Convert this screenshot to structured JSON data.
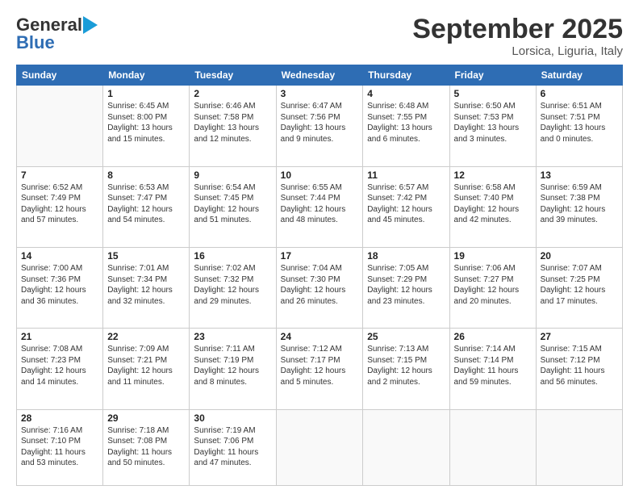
{
  "header": {
    "logo_general": "General",
    "logo_blue": "Blue",
    "title": "September 2025",
    "location": "Lorsica, Liguria, Italy"
  },
  "calendar": {
    "days_of_week": [
      "Sunday",
      "Monday",
      "Tuesday",
      "Wednesday",
      "Thursday",
      "Friday",
      "Saturday"
    ],
    "weeks": [
      [
        {
          "day": "",
          "info": ""
        },
        {
          "day": "1",
          "info": "Sunrise: 6:45 AM\nSunset: 8:00 PM\nDaylight: 13 hours\nand 15 minutes."
        },
        {
          "day": "2",
          "info": "Sunrise: 6:46 AM\nSunset: 7:58 PM\nDaylight: 13 hours\nand 12 minutes."
        },
        {
          "day": "3",
          "info": "Sunrise: 6:47 AM\nSunset: 7:56 PM\nDaylight: 13 hours\nand 9 minutes."
        },
        {
          "day": "4",
          "info": "Sunrise: 6:48 AM\nSunset: 7:55 PM\nDaylight: 13 hours\nand 6 minutes."
        },
        {
          "day": "5",
          "info": "Sunrise: 6:50 AM\nSunset: 7:53 PM\nDaylight: 13 hours\nand 3 minutes."
        },
        {
          "day": "6",
          "info": "Sunrise: 6:51 AM\nSunset: 7:51 PM\nDaylight: 13 hours\nand 0 minutes."
        }
      ],
      [
        {
          "day": "7",
          "info": "Sunrise: 6:52 AM\nSunset: 7:49 PM\nDaylight: 12 hours\nand 57 minutes."
        },
        {
          "day": "8",
          "info": "Sunrise: 6:53 AM\nSunset: 7:47 PM\nDaylight: 12 hours\nand 54 minutes."
        },
        {
          "day": "9",
          "info": "Sunrise: 6:54 AM\nSunset: 7:45 PM\nDaylight: 12 hours\nand 51 minutes."
        },
        {
          "day": "10",
          "info": "Sunrise: 6:55 AM\nSunset: 7:44 PM\nDaylight: 12 hours\nand 48 minutes."
        },
        {
          "day": "11",
          "info": "Sunrise: 6:57 AM\nSunset: 7:42 PM\nDaylight: 12 hours\nand 45 minutes."
        },
        {
          "day": "12",
          "info": "Sunrise: 6:58 AM\nSunset: 7:40 PM\nDaylight: 12 hours\nand 42 minutes."
        },
        {
          "day": "13",
          "info": "Sunrise: 6:59 AM\nSunset: 7:38 PM\nDaylight: 12 hours\nand 39 minutes."
        }
      ],
      [
        {
          "day": "14",
          "info": "Sunrise: 7:00 AM\nSunset: 7:36 PM\nDaylight: 12 hours\nand 36 minutes."
        },
        {
          "day": "15",
          "info": "Sunrise: 7:01 AM\nSunset: 7:34 PM\nDaylight: 12 hours\nand 32 minutes."
        },
        {
          "day": "16",
          "info": "Sunrise: 7:02 AM\nSunset: 7:32 PM\nDaylight: 12 hours\nand 29 minutes."
        },
        {
          "day": "17",
          "info": "Sunrise: 7:04 AM\nSunset: 7:30 PM\nDaylight: 12 hours\nand 26 minutes."
        },
        {
          "day": "18",
          "info": "Sunrise: 7:05 AM\nSunset: 7:29 PM\nDaylight: 12 hours\nand 23 minutes."
        },
        {
          "day": "19",
          "info": "Sunrise: 7:06 AM\nSunset: 7:27 PM\nDaylight: 12 hours\nand 20 minutes."
        },
        {
          "day": "20",
          "info": "Sunrise: 7:07 AM\nSunset: 7:25 PM\nDaylight: 12 hours\nand 17 minutes."
        }
      ],
      [
        {
          "day": "21",
          "info": "Sunrise: 7:08 AM\nSunset: 7:23 PM\nDaylight: 12 hours\nand 14 minutes."
        },
        {
          "day": "22",
          "info": "Sunrise: 7:09 AM\nSunset: 7:21 PM\nDaylight: 12 hours\nand 11 minutes."
        },
        {
          "day": "23",
          "info": "Sunrise: 7:11 AM\nSunset: 7:19 PM\nDaylight: 12 hours\nand 8 minutes."
        },
        {
          "day": "24",
          "info": "Sunrise: 7:12 AM\nSunset: 7:17 PM\nDaylight: 12 hours\nand 5 minutes."
        },
        {
          "day": "25",
          "info": "Sunrise: 7:13 AM\nSunset: 7:15 PM\nDaylight: 12 hours\nand 2 minutes."
        },
        {
          "day": "26",
          "info": "Sunrise: 7:14 AM\nSunset: 7:14 PM\nDaylight: 11 hours\nand 59 minutes."
        },
        {
          "day": "27",
          "info": "Sunrise: 7:15 AM\nSunset: 7:12 PM\nDaylight: 11 hours\nand 56 minutes."
        }
      ],
      [
        {
          "day": "28",
          "info": "Sunrise: 7:16 AM\nSunset: 7:10 PM\nDaylight: 11 hours\nand 53 minutes."
        },
        {
          "day": "29",
          "info": "Sunrise: 7:18 AM\nSunset: 7:08 PM\nDaylight: 11 hours\nand 50 minutes."
        },
        {
          "day": "30",
          "info": "Sunrise: 7:19 AM\nSunset: 7:06 PM\nDaylight: 11 hours\nand 47 minutes."
        },
        {
          "day": "",
          "info": ""
        },
        {
          "day": "",
          "info": ""
        },
        {
          "day": "",
          "info": ""
        },
        {
          "day": "",
          "info": ""
        }
      ]
    ]
  }
}
